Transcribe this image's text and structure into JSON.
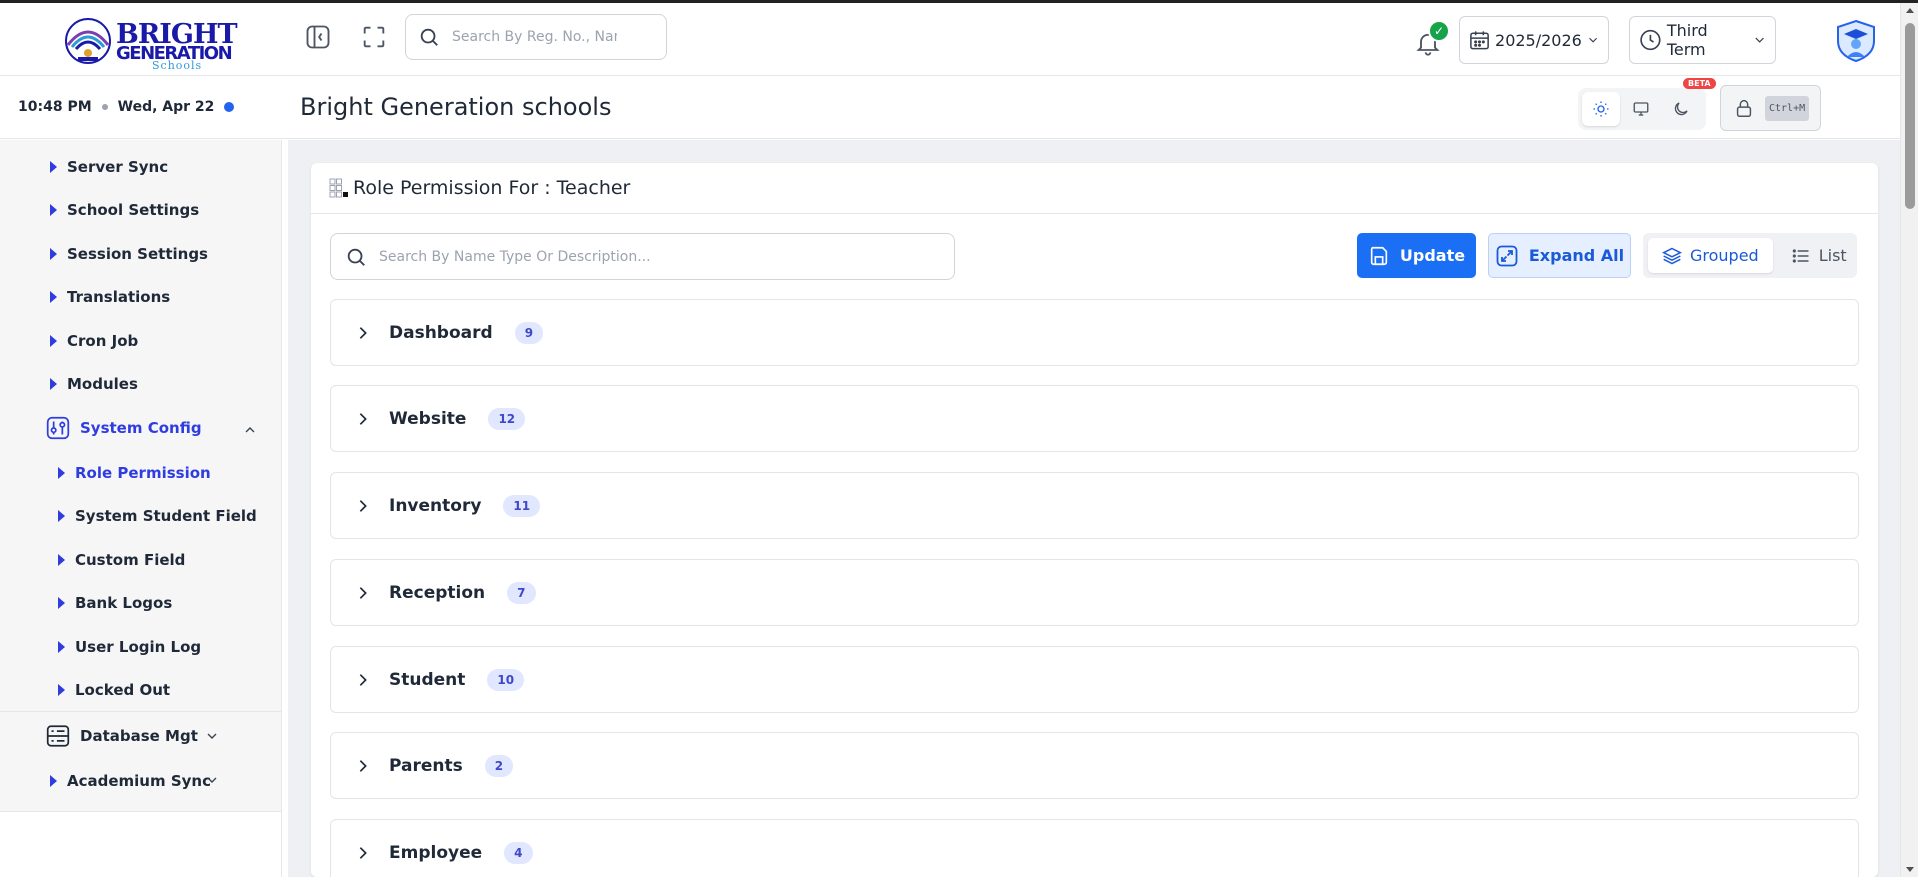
{
  "header": {
    "logo": {
      "line1": "BRIGHT",
      "line2": "GENERATION",
      "line3": "Schools"
    },
    "search_placeholder": "Search By Reg. No., Name",
    "notification_badge": "✓",
    "session": "2025/2026",
    "term": "Third Term"
  },
  "subheader": {
    "time": "10:48 PM",
    "date": "Wed, Apr 22",
    "page_title": "Bright Generation schools",
    "beta_label": "BETA",
    "lock_shortcut": "Ctrl+M"
  },
  "sidebar": {
    "items": [
      {
        "label": "Server Sync"
      },
      {
        "label": "School Settings"
      },
      {
        "label": "Session Settings"
      },
      {
        "label": "Translations"
      },
      {
        "label": "Cron Job"
      },
      {
        "label": "Modules"
      }
    ],
    "system_config": {
      "label": "System Config",
      "children": [
        {
          "label": "Role Permission"
        },
        {
          "label": "System Student Field"
        },
        {
          "label": "Custom Field"
        },
        {
          "label": "Bank Logos"
        },
        {
          "label": "User Login Log"
        },
        {
          "label": "Locked Out"
        }
      ]
    },
    "database_mgt": {
      "label": "Database Mgt"
    },
    "academium_sync": {
      "label": "Academium Sync"
    }
  },
  "main": {
    "card_title": "Role Permission For : Teacher",
    "search_placeholder": "Search By Name Type Or Description...",
    "update_label": "Update",
    "expand_label": "Expand All",
    "view_grouped": "Grouped",
    "view_list": "List",
    "groups": [
      {
        "name": "Dashboard",
        "count": "9"
      },
      {
        "name": "Website",
        "count": "12"
      },
      {
        "name": "Inventory",
        "count": "11"
      },
      {
        "name": "Reception",
        "count": "7"
      },
      {
        "name": "Student",
        "count": "10"
      },
      {
        "name": "Parents",
        "count": "2"
      },
      {
        "name": "Employee",
        "count": "4"
      }
    ]
  },
  "colors": {
    "accent": "#1a6ff5",
    "sidebar_active": "#2f3de0",
    "badge_bg": "#e0e7ff",
    "success": "#16a34a",
    "beta": "#ef4444"
  }
}
